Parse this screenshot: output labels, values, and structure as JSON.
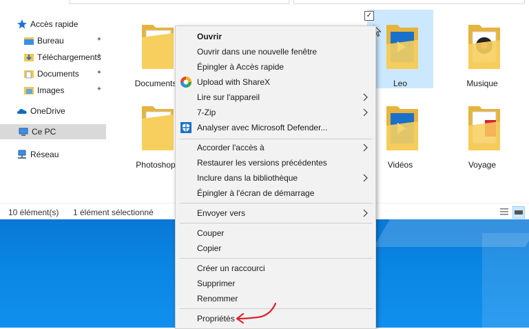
{
  "sidebar": {
    "items": [
      {
        "label": "Accès rapide",
        "icon": "star-icon"
      },
      {
        "label": "Bureau",
        "icon": "desktop-folder-icon"
      },
      {
        "label": "Téléchargements",
        "icon": "downloads-folder-icon"
      },
      {
        "label": "Documents",
        "icon": "documents-folder-icon"
      },
      {
        "label": "Images",
        "icon": "images-folder-icon"
      },
      {
        "label": "OneDrive",
        "icon": "onedrive-cloud-icon"
      },
      {
        "label": "Ce PC",
        "icon": "computer-icon"
      },
      {
        "label": "Réseau",
        "icon": "network-icon"
      }
    ]
  },
  "files": [
    {
      "label": "Documents"
    },
    {
      "label": "Leo"
    },
    {
      "label": "Musique"
    },
    {
      "label": "Photoshop"
    },
    {
      "label": "Vidéos"
    },
    {
      "label": "Voyage"
    }
  ],
  "status": {
    "count": "10 élément(s)",
    "selection": "1 élément sélectionné"
  },
  "menu": {
    "items": [
      {
        "label": "Ouvrir"
      },
      {
        "label": "Ouvrir dans une nouvelle fenêtre"
      },
      {
        "label": "Épingler à Accès rapide"
      },
      {
        "label": "Upload with ShareX"
      },
      {
        "label": "Lire sur l'appareil"
      },
      {
        "label": "7-Zip"
      },
      {
        "label": "Analyser avec Microsoft Defender..."
      },
      {
        "label": "Accorder l'accès à"
      },
      {
        "label": "Restaurer les versions précédentes"
      },
      {
        "label": "Inclure dans la bibliothèque"
      },
      {
        "label": "Épingler à l'écran de démarrage"
      },
      {
        "label": "Envoyer vers"
      },
      {
        "label": "Couper"
      },
      {
        "label": "Copier"
      },
      {
        "label": "Créer un raccourci"
      },
      {
        "label": "Supprimer"
      },
      {
        "label": "Renommer"
      },
      {
        "label": "Propriétés"
      }
    ]
  },
  "colors": {
    "selection": "#cce8ff",
    "desktop": "#0a78d6",
    "annotation_arrow": "#d9232e",
    "folder": "#f5c84c"
  }
}
